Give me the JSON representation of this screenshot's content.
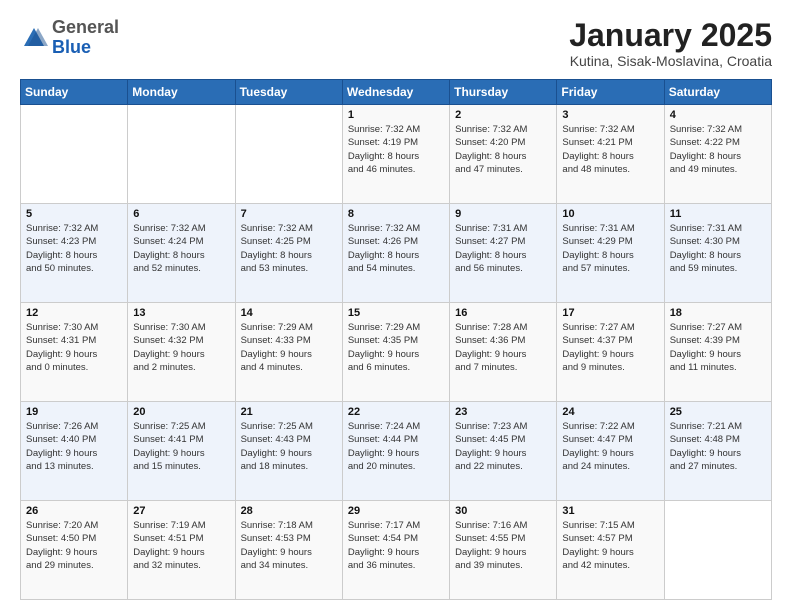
{
  "logo": {
    "general": "General",
    "blue": "Blue"
  },
  "header": {
    "title": "January 2025",
    "subtitle": "Kutina, Sisak-Moslavina, Croatia"
  },
  "weekdays": [
    "Sunday",
    "Monday",
    "Tuesday",
    "Wednesday",
    "Thursday",
    "Friday",
    "Saturday"
  ],
  "weeks": [
    [
      {
        "day": "",
        "info": ""
      },
      {
        "day": "",
        "info": ""
      },
      {
        "day": "",
        "info": ""
      },
      {
        "day": "1",
        "info": "Sunrise: 7:32 AM\nSunset: 4:19 PM\nDaylight: 8 hours\nand 46 minutes."
      },
      {
        "day": "2",
        "info": "Sunrise: 7:32 AM\nSunset: 4:20 PM\nDaylight: 8 hours\nand 47 minutes."
      },
      {
        "day": "3",
        "info": "Sunrise: 7:32 AM\nSunset: 4:21 PM\nDaylight: 8 hours\nand 48 minutes."
      },
      {
        "day": "4",
        "info": "Sunrise: 7:32 AM\nSunset: 4:22 PM\nDaylight: 8 hours\nand 49 minutes."
      }
    ],
    [
      {
        "day": "5",
        "info": "Sunrise: 7:32 AM\nSunset: 4:23 PM\nDaylight: 8 hours\nand 50 minutes."
      },
      {
        "day": "6",
        "info": "Sunrise: 7:32 AM\nSunset: 4:24 PM\nDaylight: 8 hours\nand 52 minutes."
      },
      {
        "day": "7",
        "info": "Sunrise: 7:32 AM\nSunset: 4:25 PM\nDaylight: 8 hours\nand 53 minutes."
      },
      {
        "day": "8",
        "info": "Sunrise: 7:32 AM\nSunset: 4:26 PM\nDaylight: 8 hours\nand 54 minutes."
      },
      {
        "day": "9",
        "info": "Sunrise: 7:31 AM\nSunset: 4:27 PM\nDaylight: 8 hours\nand 56 minutes."
      },
      {
        "day": "10",
        "info": "Sunrise: 7:31 AM\nSunset: 4:29 PM\nDaylight: 8 hours\nand 57 minutes."
      },
      {
        "day": "11",
        "info": "Sunrise: 7:31 AM\nSunset: 4:30 PM\nDaylight: 8 hours\nand 59 minutes."
      }
    ],
    [
      {
        "day": "12",
        "info": "Sunrise: 7:30 AM\nSunset: 4:31 PM\nDaylight: 9 hours\nand 0 minutes."
      },
      {
        "day": "13",
        "info": "Sunrise: 7:30 AM\nSunset: 4:32 PM\nDaylight: 9 hours\nand 2 minutes."
      },
      {
        "day": "14",
        "info": "Sunrise: 7:29 AM\nSunset: 4:33 PM\nDaylight: 9 hours\nand 4 minutes."
      },
      {
        "day": "15",
        "info": "Sunrise: 7:29 AM\nSunset: 4:35 PM\nDaylight: 9 hours\nand 6 minutes."
      },
      {
        "day": "16",
        "info": "Sunrise: 7:28 AM\nSunset: 4:36 PM\nDaylight: 9 hours\nand 7 minutes."
      },
      {
        "day": "17",
        "info": "Sunrise: 7:27 AM\nSunset: 4:37 PM\nDaylight: 9 hours\nand 9 minutes."
      },
      {
        "day": "18",
        "info": "Sunrise: 7:27 AM\nSunset: 4:39 PM\nDaylight: 9 hours\nand 11 minutes."
      }
    ],
    [
      {
        "day": "19",
        "info": "Sunrise: 7:26 AM\nSunset: 4:40 PM\nDaylight: 9 hours\nand 13 minutes."
      },
      {
        "day": "20",
        "info": "Sunrise: 7:25 AM\nSunset: 4:41 PM\nDaylight: 9 hours\nand 15 minutes."
      },
      {
        "day": "21",
        "info": "Sunrise: 7:25 AM\nSunset: 4:43 PM\nDaylight: 9 hours\nand 18 minutes."
      },
      {
        "day": "22",
        "info": "Sunrise: 7:24 AM\nSunset: 4:44 PM\nDaylight: 9 hours\nand 20 minutes."
      },
      {
        "day": "23",
        "info": "Sunrise: 7:23 AM\nSunset: 4:45 PM\nDaylight: 9 hours\nand 22 minutes."
      },
      {
        "day": "24",
        "info": "Sunrise: 7:22 AM\nSunset: 4:47 PM\nDaylight: 9 hours\nand 24 minutes."
      },
      {
        "day": "25",
        "info": "Sunrise: 7:21 AM\nSunset: 4:48 PM\nDaylight: 9 hours\nand 27 minutes."
      }
    ],
    [
      {
        "day": "26",
        "info": "Sunrise: 7:20 AM\nSunset: 4:50 PM\nDaylight: 9 hours\nand 29 minutes."
      },
      {
        "day": "27",
        "info": "Sunrise: 7:19 AM\nSunset: 4:51 PM\nDaylight: 9 hours\nand 32 minutes."
      },
      {
        "day": "28",
        "info": "Sunrise: 7:18 AM\nSunset: 4:53 PM\nDaylight: 9 hours\nand 34 minutes."
      },
      {
        "day": "29",
        "info": "Sunrise: 7:17 AM\nSunset: 4:54 PM\nDaylight: 9 hours\nand 36 minutes."
      },
      {
        "day": "30",
        "info": "Sunrise: 7:16 AM\nSunset: 4:55 PM\nDaylight: 9 hours\nand 39 minutes."
      },
      {
        "day": "31",
        "info": "Sunrise: 7:15 AM\nSunset: 4:57 PM\nDaylight: 9 hours\nand 42 minutes."
      },
      {
        "day": "",
        "info": ""
      }
    ]
  ]
}
